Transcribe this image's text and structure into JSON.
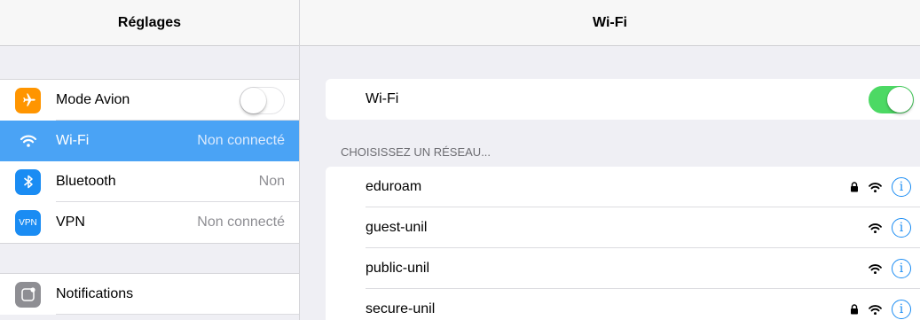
{
  "left": {
    "title": "Réglages",
    "items": [
      {
        "label": "Mode Avion",
        "value": "",
        "icon": "airplane-icon",
        "toggle": false
      },
      {
        "label": "Wi-Fi",
        "value": "Non connecté",
        "icon": "wifi-icon",
        "selected": true
      },
      {
        "label": "Bluetooth",
        "value": "Non",
        "icon": "bluetooth-icon"
      },
      {
        "label": "VPN",
        "value": "Non connecté",
        "icon": "vpn-icon",
        "icon_text": "VPN"
      },
      {
        "label": "Notifications",
        "value": "",
        "icon": "notifications-icon"
      }
    ]
  },
  "right": {
    "title": "Wi-Fi",
    "wifi_toggle": {
      "label": "Wi-Fi",
      "on": true
    },
    "section_header": "CHOISISSEZ UN RÉSEAU...",
    "networks": [
      {
        "name": "eduroam",
        "locked": true
      },
      {
        "name": "guest-unil",
        "locked": false
      },
      {
        "name": "public-unil",
        "locked": false
      },
      {
        "name": "secure-unil",
        "locked": true
      }
    ]
  },
  "colors": {
    "accent": "#1a8cf3",
    "selected_row": "#4aa3f5",
    "toggle_on": "#4cd964",
    "airplane": "#ff9500"
  }
}
